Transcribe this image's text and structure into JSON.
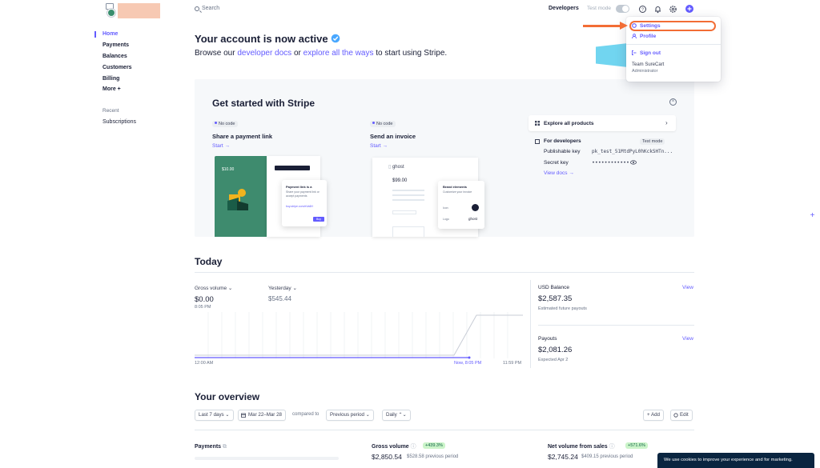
{
  "colors": {
    "accent": "#635bff",
    "annotation": "#f26d35",
    "highlight": "#71d5f0"
  },
  "sidebar": {
    "items": [
      {
        "label": "Home",
        "active": true
      },
      {
        "label": "Payments"
      },
      {
        "label": "Balances"
      },
      {
        "label": "Customers"
      },
      {
        "label": "Billing"
      },
      {
        "label": "More +"
      }
    ],
    "recent_heading": "Recent",
    "recent_items": [
      "Subscriptions"
    ]
  },
  "topbar": {
    "search_placeholder": "Search",
    "developers": "Developers",
    "test_mode": "Test mode",
    "icons": [
      "help-icon",
      "bell-icon",
      "gear-icon",
      "plus-icon"
    ]
  },
  "dropdown": {
    "settings": "Settings",
    "profile": "Profile",
    "sign_out": "Sign out",
    "account_name": "Team SureCart",
    "account_role": "Administrator"
  },
  "hero": {
    "title": "Your account is now active",
    "sub_pre": "Browse our ",
    "sub_link1": "developer docs",
    "sub_mid": " or ",
    "sub_link2": "explore all the ways",
    "sub_post": " to start using Stripe."
  },
  "get_started": {
    "title": "Get started with Stripe",
    "cards": [
      {
        "badge": "No code",
        "title": "Share a payment link",
        "link": "Start →"
      },
      {
        "badge": "No code",
        "title": "Send an invoice",
        "link": "Start →"
      }
    ],
    "explore_label": "Explore all products",
    "for_developers": "For developers",
    "test_mode_badge": "Test mode",
    "publishable_key_label": "Publishable key",
    "publishable_key_value": "pk_test_51MtdPyL0hKckSHTn...",
    "secret_key_label": "Secret key",
    "secret_key_value": "••••••••••••",
    "view_docs": "View docs →",
    "illustration": {
      "green_price": "$10.00",
      "payment_link_title": "Payment link is a",
      "payment_link_text1": "Share your payment link or",
      "payment_link_text2": "accept payments",
      "url": "buy.stripe.com/eVa6H",
      "buy_btn": "Buy",
      "ghost_brand": "ghost",
      "invoice_amount": "$99.00",
      "brand_elements": "Brand elements",
      "brand_text": "Customize your invoice",
      "icon_label": "Icon",
      "logo_label": "Logo"
    }
  },
  "today": {
    "title": "Today",
    "gross_volume_label": "Gross volume ⌄",
    "gross_volume_value": "$0.00",
    "gross_volume_time": "8:05 PM",
    "yesterday_label": "Yesterday ⌄",
    "yesterday_value": "$545.44",
    "x_start": "12:00 AM",
    "x_now": "Now, 8:05 PM",
    "x_end": "11:59 PM",
    "usd_balance_label": "USD Balance",
    "usd_balance_value": "$2,587.35",
    "usd_balance_sub": "Estimated future payouts",
    "payouts_label": "Payouts",
    "payouts_value": "$2,081.26",
    "payouts_sub": "Expected Apr 2",
    "view": "View"
  },
  "overview": {
    "title": "Your overview",
    "range_chip": "Last 7 days ⌄",
    "date_chip": "Mar 22–Mar 28",
    "compared_to": "compared to",
    "previous_period_chip": "Previous period ⌄",
    "daily_chip": "Daily ⌃⌄",
    "add_btn": "+ Add",
    "edit_btn": "Edit",
    "payments_label": "Payments",
    "gross_volume_label": "Gross volume",
    "gross_volume_delta": "+439.3%",
    "gross_volume_value": "$2,850.54",
    "gross_volume_prev": "$528.58 previous period",
    "net_volume_label": "Net volume from sales",
    "net_volume_delta": "+571.6%",
    "net_volume_value": "$2,745.24",
    "net_volume_prev": "$409.15 previous period"
  },
  "cookie": {
    "text": "We use cookies to improve your experience and for marketing."
  }
}
